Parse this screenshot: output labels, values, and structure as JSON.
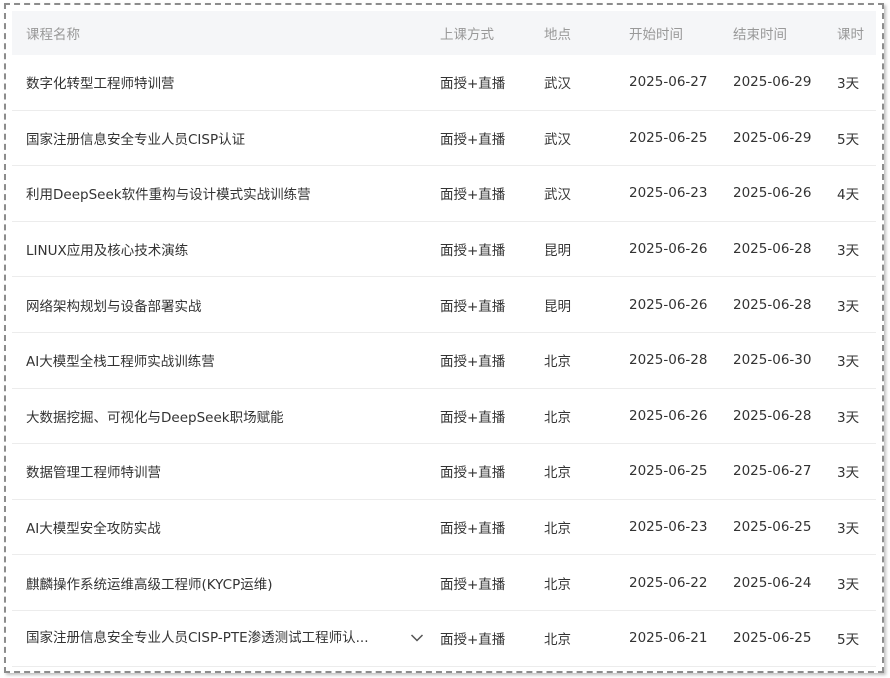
{
  "table": {
    "headers": {
      "name": "课程名称",
      "mode": "上课方式",
      "location": "地点",
      "start": "开始时间",
      "end": "结束时间",
      "duration": "课时"
    },
    "rows": [
      {
        "name": "数字化转型工程师特训营",
        "mode": "面授+直播",
        "location": "武汉",
        "start": "2025-06-27",
        "end": "2025-06-29",
        "duration": "3天"
      },
      {
        "name": "国家注册信息安全专业人员CISP认证",
        "mode": "面授+直播",
        "location": "武汉",
        "start": "2025-06-25",
        "end": "2025-06-29",
        "duration": "5天"
      },
      {
        "name": "利用DeepSeek软件重构与设计模式实战训练营",
        "mode": "面授+直播",
        "location": "武汉",
        "start": "2025-06-23",
        "end": "2025-06-26",
        "duration": "4天"
      },
      {
        "name": "LINUX应用及核心技术演练",
        "mode": "面授+直播",
        "location": "昆明",
        "start": "2025-06-26",
        "end": "2025-06-28",
        "duration": "3天"
      },
      {
        "name": "网络架构规划与设备部署实战",
        "mode": "面授+直播",
        "location": "昆明",
        "start": "2025-06-26",
        "end": "2025-06-28",
        "duration": "3天"
      },
      {
        "name": "AI大模型全栈工程师实战训练营",
        "mode": "面授+直播",
        "location": "北京",
        "start": "2025-06-28",
        "end": "2025-06-30",
        "duration": "3天"
      },
      {
        "name": "大数据挖掘、可视化与DeepSeek职场赋能",
        "mode": "面授+直播",
        "location": "北京",
        "start": "2025-06-26",
        "end": "2025-06-28",
        "duration": "3天"
      },
      {
        "name": "数据管理工程师特训营",
        "mode": "面授+直播",
        "location": "北京",
        "start": "2025-06-25",
        "end": "2025-06-27",
        "duration": "3天"
      },
      {
        "name": "AI大模型安全攻防实战",
        "mode": "面授+直播",
        "location": "北京",
        "start": "2025-06-23",
        "end": "2025-06-25",
        "duration": "3天"
      },
      {
        "name": "麒麟操作系统运维高级工程师(KYCP运维)",
        "mode": "面授+直播",
        "location": "北京",
        "start": "2025-06-22",
        "end": "2025-06-24",
        "duration": "3天"
      },
      {
        "name": "国家注册信息安全专业人员CISP-PTE渗透测试工程师认...",
        "mode": "面授+直播",
        "location": "北京",
        "start": "2025-06-21",
        "end": "2025-06-25",
        "duration": "5天"
      }
    ]
  },
  "icons": {
    "expand": "chevron-down-icon"
  }
}
